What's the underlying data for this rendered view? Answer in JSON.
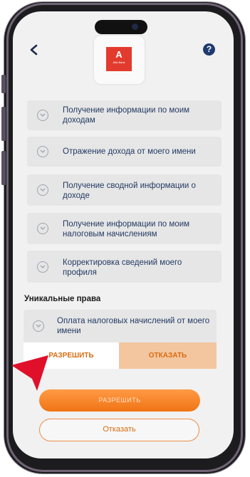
{
  "app": {
    "logo_letter": "A",
    "logo_text": "Alfa Bank"
  },
  "header": {
    "help_symbol": "?"
  },
  "permissions": [
    "Получение информации по моим доходам",
    "Отражение дохода от моего имени",
    "Получение сводной информации о доходе",
    "Получение информации по моим налоговым начислениям",
    "Корректировка сведений моего профиля"
  ],
  "unique_rights": {
    "title": "Уникальные права",
    "item": "Оплата налоговых начислений от моего имени",
    "allow_label": "РАЗРЕШИТЬ",
    "deny_label": "ОТКАЗАТЬ"
  },
  "actions": {
    "allow_label": "РАЗРЕШИТЬ",
    "deny_label": "Отказать"
  },
  "colors": {
    "accent": "#f07415",
    "text": "#233a63",
    "arrow": "#e0102a"
  }
}
